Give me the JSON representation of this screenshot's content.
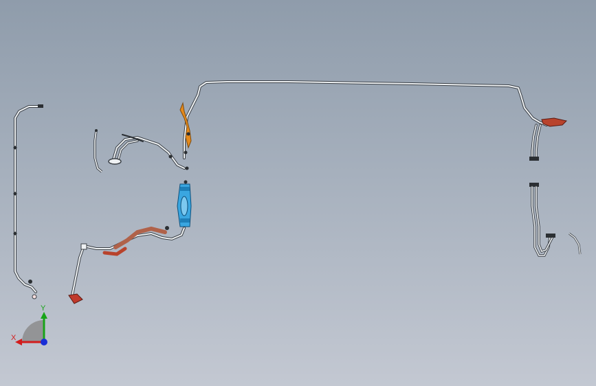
{
  "viewport": {
    "background_top": "#8f9cab",
    "background_bottom": "#c3c8d2"
  },
  "model": {
    "tube_color": "#e8ecef",
    "tube_outline": "#3a3f45",
    "highlight_blue": "#3aa6e0",
    "highlight_orange": "#e58a1c",
    "highlight_red": "#b8432c",
    "highlight_copper": "#b0624a"
  },
  "triad": {
    "x_label": "X",
    "y_label": "Y",
    "x_color": "#d21c1c",
    "y_color": "#18a418",
    "z_color": "#1a2fd6"
  }
}
